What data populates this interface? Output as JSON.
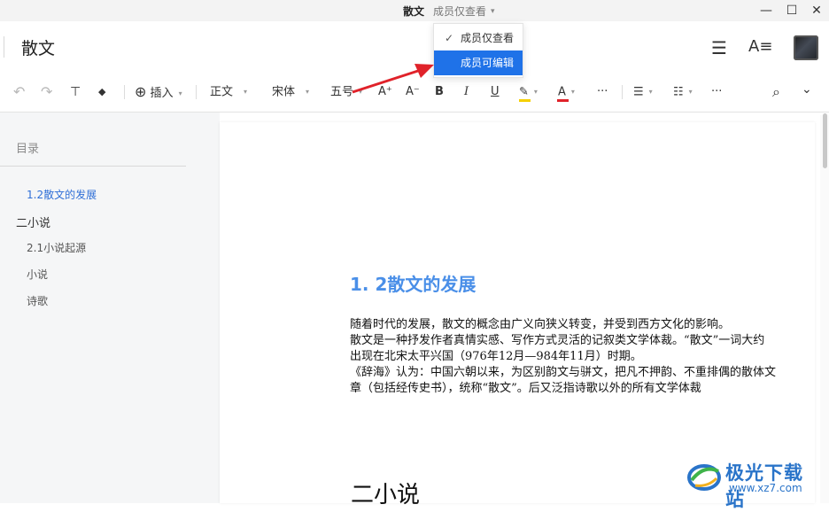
{
  "titlebar": {
    "doc_name": "散文",
    "permission": "成员仅查看",
    "caret": "▾",
    "min": "—",
    "max": "☐",
    "close": "✕"
  },
  "header": {
    "title": "散文",
    "menu_icon": "☰",
    "font_icon": "A≡"
  },
  "toolbar": {
    "undo": "↶",
    "redo": "↷",
    "format_painter": "⊤",
    "eraser": "◆",
    "insert_icon": "⊕",
    "insert": "插入",
    "style": "正文",
    "font": "宋体",
    "size": "五号",
    "grow": "A⁺",
    "shrink": "A⁻",
    "bold": "B",
    "italic": "I",
    "underline": "U",
    "highlight": "✎",
    "color": "A",
    "more1": "···",
    "bullets": "☰",
    "numbers": "☷",
    "more2": "···",
    "search": "⌕",
    "expand": "⌄",
    "dd": "▾",
    "highlight_color": "#f5d000",
    "font_color": "#e0222a"
  },
  "dropdown": {
    "check": "✓",
    "option1": "成员仅查看",
    "option2": "成员可编辑"
  },
  "sidebar": {
    "title": "目录",
    "items": [
      {
        "label": "1.2散文的发展"
      },
      {
        "label": "二小说"
      },
      {
        "label": "2.1小说起源"
      },
      {
        "label": "小说"
      },
      {
        "label": "诗歌"
      }
    ]
  },
  "doc": {
    "heading": "1. 2散文的发展",
    "para": [
      "随着时代的发展，散文的概念由广义向狭义转变，并受到西方文化的影响。",
      "散文是一种抒发作者真情实感、写作方式灵活的记叙类文学体裁。“散文”一词大约",
      "出现在北宋太平兴国（976年12月—984年11月）时期。",
      "《辞海》认为：中国六朝以来，为区别韵文与骈文，把凡不押韵、不重排偶的散体文",
      "章（包括经传史书），统称“散文”。后又泛指诗歌以外的所有文学体裁"
    ],
    "heading2": "二小说"
  },
  "watermark": {
    "name": "极光下载站",
    "url": "www.xz7.com"
  },
  "colors": {
    "accent": "#1f72e8",
    "heading": "#4a8fe8",
    "toc_active": "#2f6fd7",
    "arrow": "#e0222a"
  }
}
